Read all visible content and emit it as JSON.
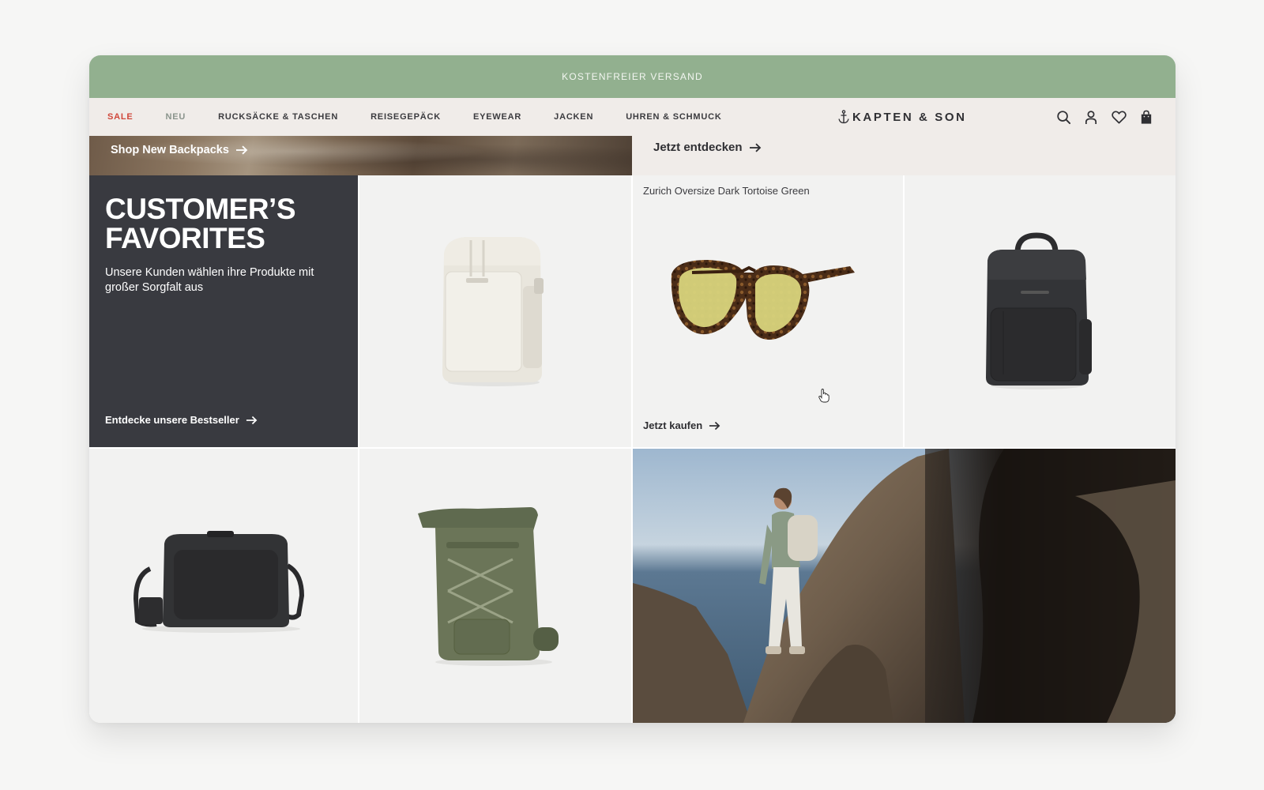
{
  "promo_bar": {
    "text": "KOSTENFREIER VERSAND"
  },
  "nav": {
    "links": [
      "SALE",
      "NEU",
      "RUCKSÄCKE & TASCHEN",
      "REISEGEPÄCK",
      "EYEWEAR",
      "JACKEN",
      "UHREN & SCHMUCK"
    ],
    "logo": "KAPTEN & SON",
    "icons": [
      "search-icon",
      "account-icon",
      "wishlist-icon",
      "cart-icon"
    ]
  },
  "hero": {
    "left_link": "Shop New Backpacks",
    "right_link": "Jetzt entdecken"
  },
  "favorites": {
    "title_line1": "CUSTOMER’S",
    "title_line2": "FAVORITES",
    "subtitle": "Unsere Kunden wählen ihre Produkte mit großer Sorgfalt aus",
    "cta": "Entdecke unsere Bestseller"
  },
  "products": {
    "glasses_name": "Zurich Oversize Dark Tortoise Green",
    "glasses_cta": "Jetzt kaufen"
  },
  "colors": {
    "promo_bar": "#92b08f",
    "nav_bg": "#f0ece9",
    "sale": "#d0473b",
    "dark_panel": "#393a40"
  }
}
